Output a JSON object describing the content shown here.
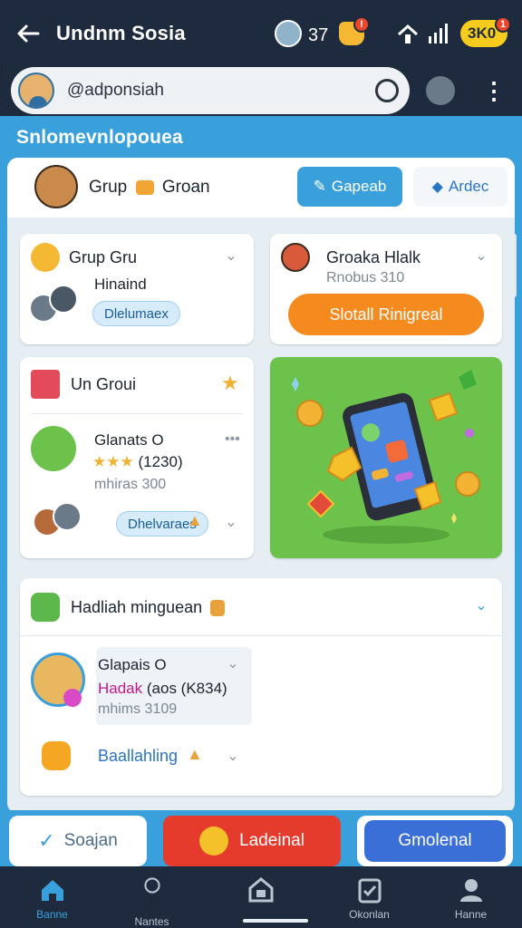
{
  "appbar": {
    "title": "Undnm Sosia",
    "user_count": "37",
    "bell_badge": "!",
    "score": "3K0"
  },
  "search": {
    "value": "@adponsiah",
    "settings_badge": "!"
  },
  "section": {
    "heading": "Snlomevnlopouea"
  },
  "groupbar": {
    "title": "Grup",
    "title2": "Groan",
    "primary_button": "Gapeab",
    "secondary_button": "Ardec"
  },
  "cards": {
    "c1": {
      "title": "Grup Gru",
      "body": "Hinaind",
      "pill": "Dlelumaex"
    },
    "c2": {
      "title": "Groaka Hlalk",
      "sub": "Rnobus 310",
      "button": "Slotall Rinigreal"
    },
    "c3": {
      "title": "Un Groui",
      "item_title": "Glanats",
      "item_suffix": "O",
      "rating_text": "(1230)",
      "item_sub": "mhiras 300",
      "pill": "Dhelvaraes"
    },
    "c5": {
      "title": "Hadliah minguean",
      "item_title": "Glapais",
      "item_suffix": "O",
      "item_highlight": "Hadak",
      "item_extra": "(aos (K834)",
      "item_sub": "mhims 3109",
      "row2_label": "Baallahling"
    }
  },
  "actions": {
    "a1": "Soajan",
    "a2": "Ladeinal",
    "a3": "Gmolenal"
  },
  "nav": {
    "items": [
      {
        "label": "Banne",
        "icon": "home-icon"
      },
      {
        "label": "Nantes",
        "icon": "chat-icon",
        "badge": "!"
      },
      {
        "label": "",
        "icon": "box-home-icon"
      },
      {
        "label": "Okonlan",
        "icon": "clipboard-icon"
      },
      {
        "label": "Hanne",
        "icon": "profile-icon"
      }
    ]
  },
  "colors": {
    "app_bg": "#1e2b3e",
    "accent_blue": "#3aa0dc",
    "orange": "#f58a1f",
    "red": "#e53b2c",
    "royal_blue": "#3a6fd8",
    "yellow": "#f5cc1e",
    "green": "#6cc24a"
  }
}
